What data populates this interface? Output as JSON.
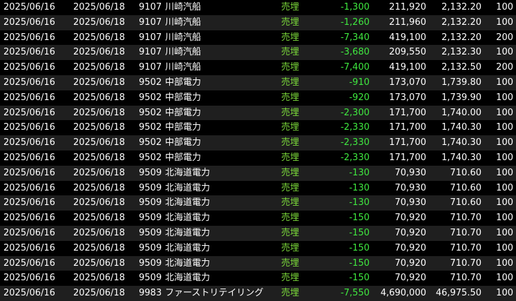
{
  "trades": [
    {
      "trade_date": "2025/06/16",
      "settle_date": "2025/06/18",
      "code": "9107",
      "name": "川崎汽船",
      "side": "売埋",
      "pl": "-1,300",
      "amount": "211,920",
      "price": "2,132.20",
      "qty": "100"
    },
    {
      "trade_date": "2025/06/16",
      "settle_date": "2025/06/18",
      "code": "9107",
      "name": "川崎汽船",
      "side": "売埋",
      "pl": "-1,260",
      "amount": "211,960",
      "price": "2,132.20",
      "qty": "100"
    },
    {
      "trade_date": "2025/06/16",
      "settle_date": "2025/06/18",
      "code": "9107",
      "name": "川崎汽船",
      "side": "売埋",
      "pl": "-7,340",
      "amount": "419,100",
      "price": "2,132.20",
      "qty": "200"
    },
    {
      "trade_date": "2025/06/16",
      "settle_date": "2025/06/18",
      "code": "9107",
      "name": "川崎汽船",
      "side": "売埋",
      "pl": "-3,680",
      "amount": "209,550",
      "price": "2,132.30",
      "qty": "100"
    },
    {
      "trade_date": "2025/06/16",
      "settle_date": "2025/06/18",
      "code": "9107",
      "name": "川崎汽船",
      "side": "売埋",
      "pl": "-7,400",
      "amount": "419,100",
      "price": "2,132.50",
      "qty": "200"
    },
    {
      "trade_date": "2025/06/16",
      "settle_date": "2025/06/18",
      "code": "9502",
      "name": "中部電力",
      "side": "売埋",
      "pl": "-910",
      "amount": "173,070",
      "price": "1,739.80",
      "qty": "100"
    },
    {
      "trade_date": "2025/06/16",
      "settle_date": "2025/06/18",
      "code": "9502",
      "name": "中部電力",
      "side": "売埋",
      "pl": "-920",
      "amount": "173,070",
      "price": "1,739.90",
      "qty": "100"
    },
    {
      "trade_date": "2025/06/16",
      "settle_date": "2025/06/18",
      "code": "9502",
      "name": "中部電力",
      "side": "売埋",
      "pl": "-2,300",
      "amount": "171,700",
      "price": "1,740.00",
      "qty": "100"
    },
    {
      "trade_date": "2025/06/16",
      "settle_date": "2025/06/18",
      "code": "9502",
      "name": "中部電力",
      "side": "売埋",
      "pl": "-2,330",
      "amount": "171,700",
      "price": "1,740.30",
      "qty": "100"
    },
    {
      "trade_date": "2025/06/16",
      "settle_date": "2025/06/18",
      "code": "9502",
      "name": "中部電力",
      "side": "売埋",
      "pl": "-2,330",
      "amount": "171,700",
      "price": "1,740.30",
      "qty": "100"
    },
    {
      "trade_date": "2025/06/16",
      "settle_date": "2025/06/18",
      "code": "9502",
      "name": "中部電力",
      "side": "売埋",
      "pl": "-2,330",
      "amount": "171,700",
      "price": "1,740.30",
      "qty": "100"
    },
    {
      "trade_date": "2025/06/16",
      "settle_date": "2025/06/18",
      "code": "9509",
      "name": "北海道電力",
      "side": "売埋",
      "pl": "-130",
      "amount": "70,930",
      "price": "710.60",
      "qty": "100"
    },
    {
      "trade_date": "2025/06/16",
      "settle_date": "2025/06/18",
      "code": "9509",
      "name": "北海道電力",
      "side": "売埋",
      "pl": "-130",
      "amount": "70,930",
      "price": "710.60",
      "qty": "100"
    },
    {
      "trade_date": "2025/06/16",
      "settle_date": "2025/06/18",
      "code": "9509",
      "name": "北海道電力",
      "side": "売埋",
      "pl": "-130",
      "amount": "70,930",
      "price": "710.60",
      "qty": "100"
    },
    {
      "trade_date": "2025/06/16",
      "settle_date": "2025/06/18",
      "code": "9509",
      "name": "北海道電力",
      "side": "売埋",
      "pl": "-150",
      "amount": "70,920",
      "price": "710.70",
      "qty": "100"
    },
    {
      "trade_date": "2025/06/16",
      "settle_date": "2025/06/18",
      "code": "9509",
      "name": "北海道電力",
      "side": "売埋",
      "pl": "-150",
      "amount": "70,920",
      "price": "710.70",
      "qty": "100"
    },
    {
      "trade_date": "2025/06/16",
      "settle_date": "2025/06/18",
      "code": "9509",
      "name": "北海道電力",
      "side": "売埋",
      "pl": "-150",
      "amount": "70,920",
      "price": "710.70",
      "qty": "100"
    },
    {
      "trade_date": "2025/06/16",
      "settle_date": "2025/06/18",
      "code": "9509",
      "name": "北海道電力",
      "side": "売埋",
      "pl": "-150",
      "amount": "70,920",
      "price": "710.70",
      "qty": "100"
    },
    {
      "trade_date": "2025/06/16",
      "settle_date": "2025/06/18",
      "code": "9509",
      "name": "北海道電力",
      "side": "売埋",
      "pl": "-150",
      "amount": "70,920",
      "price": "710.70",
      "qty": "100"
    },
    {
      "trade_date": "2025/06/16",
      "settle_date": "2025/06/18",
      "code": "9983",
      "name": "ファーストリテイリング",
      "side": "売埋",
      "pl": "-7,550",
      "amount": "4,690,000",
      "price": "46,975.50",
      "qty": "100"
    }
  ],
  "colors": {
    "background": "#000000",
    "row_alt": "#1f1f1f",
    "text": "#ffffff",
    "side_text": "#7bd93a",
    "pl_text": "#3fe83f"
  }
}
